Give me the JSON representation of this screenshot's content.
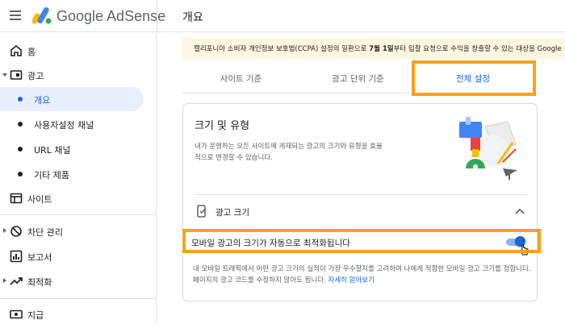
{
  "header": {
    "brand": "Google AdSense",
    "page_title": "개요"
  },
  "sidebar": {
    "items": [
      {
        "label": "홈",
        "icon": "home-icon"
      },
      {
        "label": "광고",
        "icon": "ads-icon"
      },
      {
        "label": "개요",
        "active": true
      },
      {
        "label": "사용자설정 채널"
      },
      {
        "label": "URL 채널"
      },
      {
        "label": "기타 제품"
      },
      {
        "label": "사이트",
        "icon": "sites-icon"
      },
      {
        "label": "차단 관리",
        "icon": "block-icon"
      },
      {
        "label": "보고서",
        "icon": "reports-icon"
      },
      {
        "label": "최적화",
        "icon": "trending-icon"
      },
      {
        "label": "지급",
        "icon": "payments-icon"
      }
    ]
  },
  "banner": {
    "text_before": "캘리포니아 소비자 개인정보 보호법(CCPA) 설정의 일환으로 ",
    "date": "7월 1일",
    "text_after": "부터 입찰 요청으로 수익을 창출할 수 있는 대상을 Google"
  },
  "tabs": [
    {
      "label": "사이트 기준"
    },
    {
      "label": "광고 단위 기준"
    },
    {
      "label": "전체 설정",
      "selected": true
    }
  ],
  "card": {
    "title": "크기 및 유형",
    "description": "내가 운영하는 모든 사이트에 게재되는 광고의 크기와 유형을 효율적으로 변경할 수 있습니다.",
    "section_title": "광고 크기",
    "setting_label": "모바일 광고의 크기가 자동으로 최적화됩니다",
    "setting_enabled": true,
    "help_text": "내 모바일 트래픽에서 어떤 광고 크기의 실적이 가장 우수할지를 고려하여 나에게 적합한 모바일 광고 크기를 정합니다. 페이지의 광고 코드를 수정하지 않아도 됩니다.",
    "learn_more": "자세히 알아보기"
  },
  "colors": {
    "accent": "#1967d2",
    "highlight": "#f7a21b",
    "banner_bg": "#fef7e0",
    "active_bg": "#e8f0fe"
  }
}
